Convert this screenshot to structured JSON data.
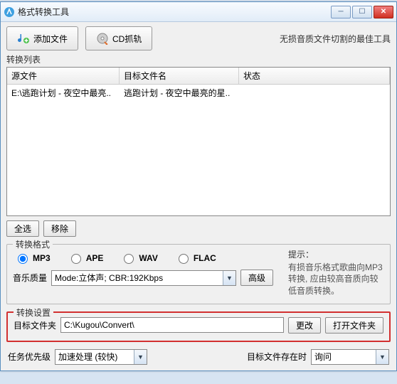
{
  "window": {
    "title": "格式转换工具",
    "min_tip": "最小化",
    "max_tip": "最大化",
    "close_tip": "关闭"
  },
  "toolbar": {
    "add_file": "添加文件",
    "cd_rip": "CD抓轨",
    "tagline": "无损音质文件切割的最佳工具"
  },
  "list": {
    "title": "转换列表",
    "columns": {
      "source": "源文件",
      "target": "目标文件名",
      "status": "状态"
    },
    "rows": [
      {
        "source": "E:\\逃跑计划 - 夜空中最亮..",
        "target": "逃跑计划 - 夜空中最亮的星..",
        "status": ""
      }
    ],
    "select_all": "全选",
    "remove": "移除"
  },
  "format": {
    "title": "转换格式",
    "options": [
      "MP3",
      "APE",
      "WAV",
      "FLAC"
    ],
    "selected": "MP3",
    "quality_label": "音乐质量",
    "quality_value": "Mode:立体声; CBR:192Kbps",
    "advanced": "高级",
    "hint_title": "提示：",
    "hint_body": "有损音乐格式歌曲向MP3转换, 应由较高音质向较低音质转换。"
  },
  "settings": {
    "title": "转换设置",
    "folder_label": "目标文件夹",
    "folder_value": "C:\\Kugou\\Convert\\",
    "change": "更改",
    "open": "打开文件夹"
  },
  "bottom": {
    "priority_label": "任务优先级",
    "priority_value": "加速处理 (较快)",
    "exists_label": "目标文件存在时",
    "exists_value": "询问"
  }
}
